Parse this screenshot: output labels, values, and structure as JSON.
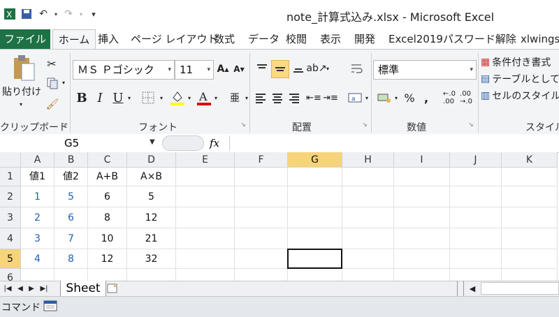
{
  "window": {
    "title": "note_計算式込み.xlsx - Microsoft Excel"
  },
  "ribbon": {
    "tabs": [
      "ファイル",
      "ホーム",
      "挿入",
      "ページ レイアウト",
      "数式",
      "データ",
      "校閲",
      "表示",
      "開発",
      "Excel2019パスワード解除",
      "xlwings"
    ],
    "active_tab": "ホーム",
    "font_name": "ＭＳ Ｐゴシック",
    "font_size": "11",
    "number_format": "標準",
    "paste_label": "貼り付け",
    "styles": [
      "条件付き書式",
      "テーブルとして書",
      "セルのスタイル"
    ],
    "groups": [
      "クリップボード",
      "フォント",
      "配置",
      "数値",
      "スタイル"
    ],
    "bold": "B",
    "italic": "I",
    "underline": "U"
  },
  "formula_bar": {
    "name_box": "G5",
    "fx": "fx",
    "formula": ""
  },
  "sheet": {
    "columns": [
      "A",
      "B",
      "C",
      "D",
      "E",
      "F",
      "G",
      "H",
      "I",
      "J",
      "K"
    ],
    "rows": [
      "1",
      "2",
      "3",
      "4",
      "5",
      "6"
    ],
    "selected_col": "G",
    "selected_row": "5",
    "cells": [
      [
        "値1",
        "値2",
        "A+B",
        "A×B"
      ],
      [
        "1",
        "5",
        "6",
        "5"
      ],
      [
        "2",
        "6",
        "8",
        "12"
      ],
      [
        "3",
        "7",
        "10",
        "21"
      ],
      [
        "4",
        "8",
        "12",
        "32"
      ]
    ],
    "tab_name": "Sheet"
  },
  "status": {
    "mode": "コマンド"
  },
  "colors": {
    "file_tab": "#1e7145",
    "selected_header": "#f7d37a",
    "value_blue": "#1f5fb0"
  }
}
